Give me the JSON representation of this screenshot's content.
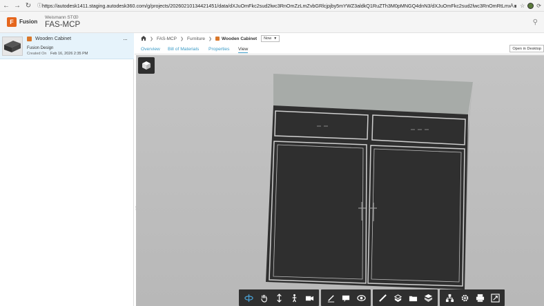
{
  "browser": {
    "url": "https://autodesk1411.staging.autodesk360.com/g/projects/20260210134421451/data/dXJuOmFkc2sud2lwc3RnOmZzLmZvbGRlcjpjby5mYWZ3aldkQ1RuZTh3M0pMNGQ4dnN3/dXJuOmFkc2sud2lwc3RnOmRtLmxpbmVhZ..."
  },
  "header": {
    "app_name": "Fusion",
    "hub_name": "Weismann STG",
    "project_name": "FAS-MCP"
  },
  "file_card": {
    "title": "Wooden Cabinet",
    "type": "Fusion Design",
    "created_label": "Created On",
    "created_date": "Feb 16, 2026 2:35 PM",
    "more": "···"
  },
  "breadcrumb": {
    "items": [
      "FAS-MCP",
      "Furniture"
    ],
    "current": "Wooden Cabinet",
    "version": "Now"
  },
  "tabs": [
    "Overview",
    "Bill of Materials",
    "Properties",
    "View"
  ],
  "active_tab": "View",
  "open_desktop": "Open in Desktop",
  "toolbar": {
    "groups": [
      [
        "orbit-icon",
        "pan-icon",
        "dolly-icon",
        "first-person-icon",
        "camera-icon"
      ],
      [
        "markup-icon",
        "comment-icon",
        "section-icon"
      ],
      [
        "measure-icon",
        "explode-icon",
        "model-browser-icon",
        "fit-icon"
      ],
      [
        "structure-icon",
        "settings-icon",
        "print-icon",
        "fullscreen-icon"
      ]
    ]
  },
  "colors": {
    "accent": "#3b9bc7",
    "fusion_orange": "#e5661d",
    "toolbar_bg": "#2f2f2f",
    "viewer_bg": "#bebebe",
    "cabinet_body": "#2f2f2f",
    "cabinet_top": "#a7aba8"
  }
}
